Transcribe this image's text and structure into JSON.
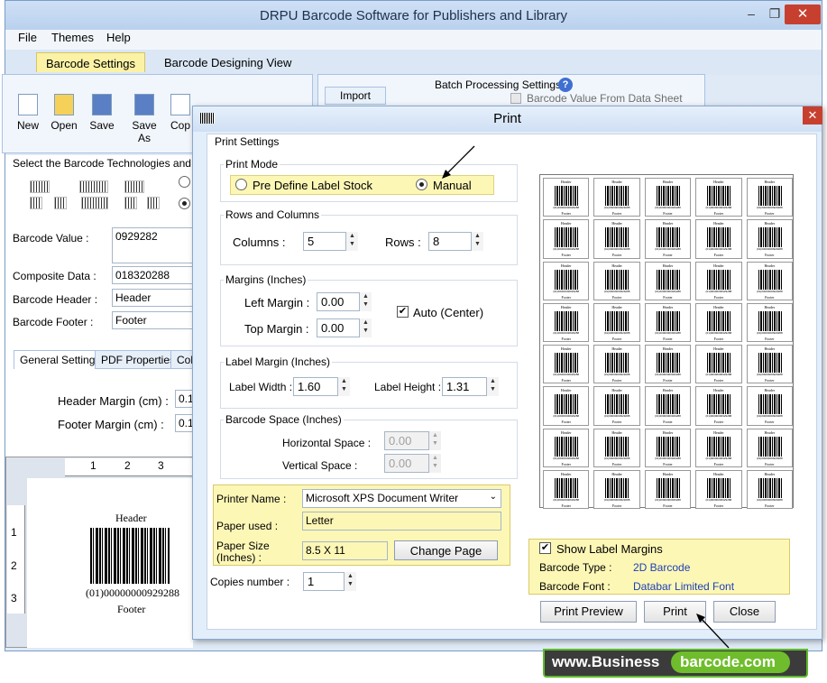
{
  "app": {
    "title": "DRPU Barcode Software for Publishers and Library"
  },
  "window_controls": {
    "minimize": "–",
    "maximize": "❐",
    "close": "✕"
  },
  "menu": [
    "File",
    "Themes",
    "Help"
  ],
  "ribbon_tabs": [
    "Barcode Settings",
    "Barcode Designing View"
  ],
  "toolbar": {
    "new": "New",
    "open": "Open",
    "save": "Save",
    "save_as": "Save As",
    "copy": "Cop"
  },
  "batch": {
    "import": "Import",
    "title": "Batch Processing Settings",
    "help": "?",
    "data_sheet": "Barcode Value From Data Sheet"
  },
  "left": {
    "tech_label": "Select the Barcode Technologies and Typ",
    "barcode_value_label": "Barcode Value :",
    "barcode_value": "0929282",
    "composite_label": "Composite Data :",
    "composite_value": "018320288",
    "header_label": "Barcode Header :",
    "header_value": "Header",
    "footer_label": "Barcode Footer :",
    "footer_value": "Footer",
    "tabs": [
      "General Settings",
      "PDF Properties",
      "Colo"
    ],
    "header_margin_label": "Header Margin (cm) :",
    "header_margin": "0.1",
    "footer_margin_label": "Footer Margin (cm) :",
    "footer_margin": "0.1",
    "ruler_top": [
      "1",
      "2",
      "3"
    ],
    "ruler_left": [
      "1",
      "2",
      "3"
    ],
    "preview_header": "Header",
    "preview_number": "(01)00000000929288",
    "preview_footer": "Footer"
  },
  "dialog": {
    "title": "Print",
    "close": "✕",
    "print_settings": "Print Settings",
    "print_mode": {
      "title": "Print Mode",
      "option1": "Pre Define Label Stock",
      "option2": "Manual",
      "selected": "Manual"
    },
    "rows_cols": {
      "title": "Rows and Columns",
      "columns_label": "Columns :",
      "columns": "5",
      "rows_label": "Rows :",
      "rows": "8"
    },
    "margins": {
      "title": "Margins (Inches)",
      "left_label": "Left Margin :",
      "left": "0.00",
      "top_label": "Top Margin :",
      "top": "0.00",
      "auto_label": "Auto (Center)",
      "auto_checked": true
    },
    "label_margin": {
      "title": "Label Margin (Inches)",
      "width_label": "Label Width :",
      "width": "1.60",
      "height_label": "Label Height :",
      "height": "1.31"
    },
    "barcode_space": {
      "title": "Barcode Space (Inches)",
      "h_label": "Horizontal Space :",
      "h": "0.00",
      "v_label": "Vertical Space :",
      "v": "0.00"
    },
    "printer": {
      "name_label": "Printer Name :",
      "name": "Microsoft XPS Document Writer",
      "paper_label": "Paper used :",
      "paper": "Letter",
      "size_label": "Paper Size",
      "size_label2": "(Inches) :",
      "size": "8.5 X 11",
      "change_page": "Change Page"
    },
    "copies_label": "Copies number :",
    "copies": "1",
    "preview_label": {
      "header": "Header",
      "number": "(01)00000000929288",
      "footer": "Footer"
    },
    "show_margins_label": "Show Label Margins",
    "show_margins_checked": true,
    "barcode_type_label": "Barcode Type :",
    "barcode_type": "2D Barcode",
    "barcode_font_label": "Barcode Font :",
    "barcode_font": "Databar Limited Font",
    "buttons": {
      "preview": "Print Preview",
      "print": "Print",
      "close": "Close"
    }
  },
  "watermark": {
    "part1": "www.Business",
    "part2": "barcode.com"
  }
}
